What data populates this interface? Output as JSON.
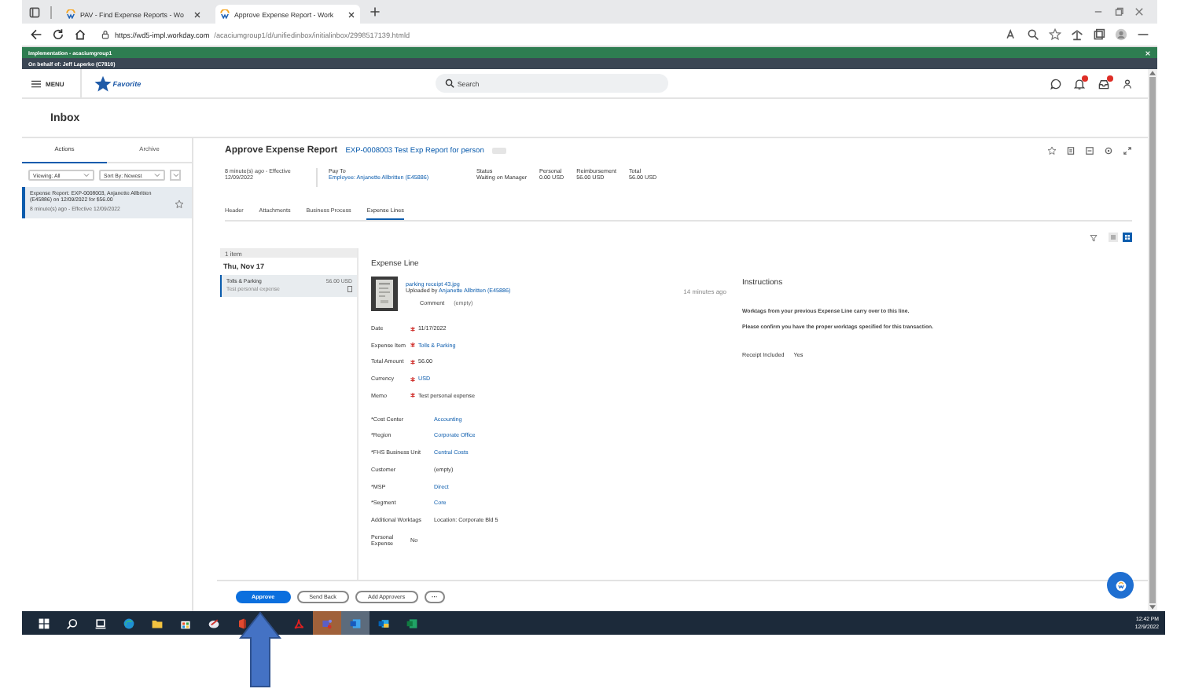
{
  "browser": {
    "tabs": [
      {
        "title": "PAV - Find Expense Reports - Wo",
        "selected": false
      },
      {
        "title": "Approve Expense Report - Work",
        "selected": true
      }
    ],
    "url_host": "https://wd5-impl.workday.com",
    "url_path": "/acaciumgroup1/d/unifiedinbox/initialinbox/2998517139.htmld"
  },
  "environment_banner": "Implementation - acaciumgroup1",
  "on_behalf_banner": "On behalf of: Jeff Laperko (C7810)",
  "header": {
    "menu_label": "MENU",
    "logo_text": "Favorite",
    "search": {
      "placeholder": "Search"
    }
  },
  "page_title": "Inbox",
  "inbox": {
    "tabs": [
      {
        "label": "Actions",
        "selected": true
      },
      {
        "label": "Archive",
        "selected": false
      }
    ],
    "filters": [
      "Viewing: All",
      "Sort By: Newest"
    ],
    "items": [
      {
        "title": "Expense Report: EXP-0008003, Anjanette Allbritten (E45886) on 12/09/2022 for $56.00",
        "meta": "8 minute(s) ago - Effective 12/09/2022",
        "selected": true
      }
    ]
  },
  "report": {
    "title": "Approve Expense Report",
    "reference": "EXP-0008003 Test Exp Report for person",
    "meta": "8 minute(s) ago - Effective 12/09/2022",
    "summary": [
      {
        "label": "Pay To",
        "value": "Employee: Anjanette Allbritten (E45886)",
        "kind": "link"
      },
      {
        "label": "Status",
        "value": "Waiting on Manager",
        "kind": "text"
      },
      {
        "label": "Personal",
        "value": "0.00 USD",
        "kind": "text"
      },
      {
        "label": "Reimbursement",
        "value": "56.00 USD",
        "kind": "text"
      },
      {
        "label": "Total",
        "value": "56.00 USD",
        "kind": "text"
      }
    ],
    "tabs": [
      {
        "label": "Header",
        "selected": false
      },
      {
        "label": "Attachments",
        "selected": false
      },
      {
        "label": "Business Process",
        "selected": false
      },
      {
        "label": "Expense Lines",
        "selected": true
      }
    ],
    "view_modes": [
      {
        "kind": "list",
        "selected": false
      },
      {
        "kind": "grid",
        "selected": true
      }
    ]
  },
  "lines": {
    "count": "1 item",
    "date": "Thu, Nov 17",
    "items": [
      {
        "name": "Tolls & Parking",
        "memo": "Test personal expense",
        "amount": "56.00 USD",
        "selected": true
      }
    ]
  },
  "expense_line": {
    "title": "Expense Line",
    "attachment": {
      "file": "parking receipt 43.jpg",
      "uploaded_by": "Uploaded by",
      "uploader": "Anjanette Allbritten (E45886)",
      "time": "14 minutes ago"
    },
    "comment": {
      "label": "Comment",
      "value": "(empty)"
    },
    "field_groups": [
      [
        {
          "label": "Date",
          "value": "11/17/2022",
          "required": true,
          "kind": "text"
        },
        {
          "label": "Expense Item",
          "value": "Tolls & Parking",
          "required": true,
          "kind": "link"
        },
        {
          "label": "Total Amount",
          "value": "56.00",
          "required": true,
          "kind": "text"
        },
        {
          "label": "Currency",
          "value": "USD",
          "required": true,
          "kind": "link"
        },
        {
          "label": "Memo",
          "value": "Test personal expense",
          "required": true,
          "kind": "text"
        }
      ],
      [
        {
          "label": "*Cost Center",
          "value": "Accounting",
          "required": false,
          "kind": "link"
        },
        {
          "label": "*Region",
          "value": "Corporate Office",
          "required": false,
          "kind": "link"
        },
        {
          "label": "*FHS Business Unit",
          "value": "Central Costs",
          "required": false,
          "kind": "link"
        },
        {
          "label": "Customer",
          "value": "(empty)",
          "required": false,
          "kind": "text"
        },
        {
          "label": "*MSP",
          "value": "Direct",
          "required": false,
          "kind": "link"
        },
        {
          "label": "*Segment",
          "value": "Core",
          "required": false,
          "kind": "link"
        },
        {
          "label": "Additional Worktags",
          "value": "Location: Corporate Bld 5",
          "required": false,
          "kind": "text"
        }
      ],
      [
        {
          "label": "Personal Expense",
          "value": "No",
          "required": false,
          "kind": "text"
        }
      ]
    ]
  },
  "instructions": {
    "title": "Instructions",
    "lines": [
      "Worktags from your previous Expense Line carry over to this line.",
      "Please confirm you have the proper worktags specified for this transaction."
    ],
    "receipt": {
      "label": "Receipt Included",
      "value": "Yes"
    }
  },
  "actions": [
    {
      "label": "Approve",
      "kind": "primary"
    },
    {
      "label": "Send Back",
      "kind": "secondary"
    },
    {
      "label": "Add Approvers",
      "kind": "secondary"
    },
    {
      "label": "···",
      "kind": "more"
    }
  ],
  "taskbar": {
    "time": "12:42 PM",
    "date": "12/9/2022"
  }
}
